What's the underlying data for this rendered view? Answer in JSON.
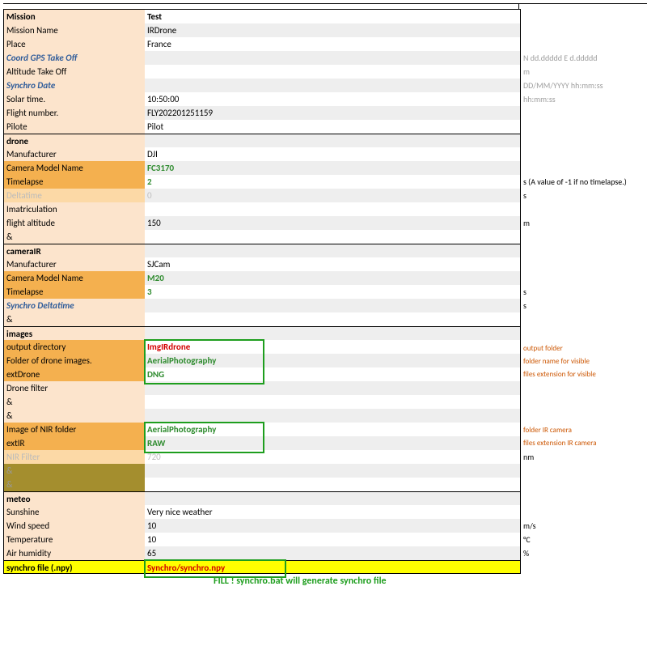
{
  "mission": {
    "section": "Mission",
    "name_value": "Test",
    "mission_name_label": "Mission Name",
    "mission_name_value": "IRDrone",
    "place_label": "Place",
    "place_value": "France",
    "coord_label": "Coord GPS Take Off",
    "coord_hint": "N dd.ddddd E d.ddddd",
    "alt_label": "Altitude Take Off",
    "alt_hint": "m",
    "synchro_date_label": "Synchro Date",
    "synchro_date_hint": "DD/MM/YYYY  hh:mm:ss",
    "solar_label": "Solar time.",
    "solar_value": "10:50:00",
    "solar_hint": "hh:mm:ss",
    "flightnum_label": "Flight number.",
    "flightnum_value": "FLY202201251159",
    "pilote_label": "Pilote",
    "pilote_value": "Pilot"
  },
  "drone": {
    "section": "drone",
    "mfr_label": "Manufacturer",
    "mfr_value": "DJI",
    "cam_label": "Camera Model Name",
    "cam_value": "FC3170",
    "timelapse_label": "Timelapse",
    "timelapse_value": "2",
    "timelapse_hint": "s  (A value of -1 if no timelapse.)",
    "delta_label": "Deltatime",
    "delta_value": "0",
    "delta_hint": "s",
    "imat_label": "Imatriculation",
    "alt_label": "flight altitude",
    "alt_value": "150",
    "alt_hint": "m",
    "amp": "&"
  },
  "cameraIR": {
    "section": "cameraIR",
    "mfr_label": "Manufacturer",
    "mfr_value": "SJCam",
    "cam_label": "Camera Model Name",
    "cam_value": "M20",
    "timelapse_label": "Timelapse",
    "timelapse_value": "3",
    "timelapse_hint": "s",
    "synchro_delta_label": "Synchro Deltatime",
    "synchro_delta_hint": "s",
    "amp": "&"
  },
  "images": {
    "section": "images",
    "outdir_label": "output directory",
    "outdir_value": "ImgIRdrone",
    "outdir_note": "output folder",
    "folder_label": "Folder of drone images.",
    "folder_value": "AerialPhotography",
    "folder_note": "folder name for visible",
    "extdrone_label": "extDrone",
    "extdrone_value": "DNG",
    "extdrone_note": "files extension for visible",
    "filter_label": "Drone filter",
    "amp": "&",
    "nirfolder_label": "Image of NIR folder",
    "nirfolder_value": "AerialPhotography",
    "nirfolder_note": "folder IR camera",
    "extir_label": "extIR",
    "extir_value": "RAW",
    "extir_note": "files extension IR camera",
    "nirfilter_label": "NIR Filter",
    "nirfilter_value": "720",
    "nirfilter_hint": "nm"
  },
  "meteo": {
    "section": "meteo",
    "sun_label": "Sunshine",
    "sun_value": "Very nice weather",
    "wind_label": "Wind speed",
    "wind_value": "10",
    "wind_hint": "m/s",
    "temp_label": "Temperature",
    "temp_value": "10",
    "temp_hint": "°C",
    "hum_label": "Air humidity",
    "hum_value": "65",
    "hum_hint": "%"
  },
  "synchro": {
    "label": "synchro file (.npy)",
    "value": "Synchro/synchro.npy",
    "footer": "FILL ! synchro.bat will generate synchro file"
  }
}
